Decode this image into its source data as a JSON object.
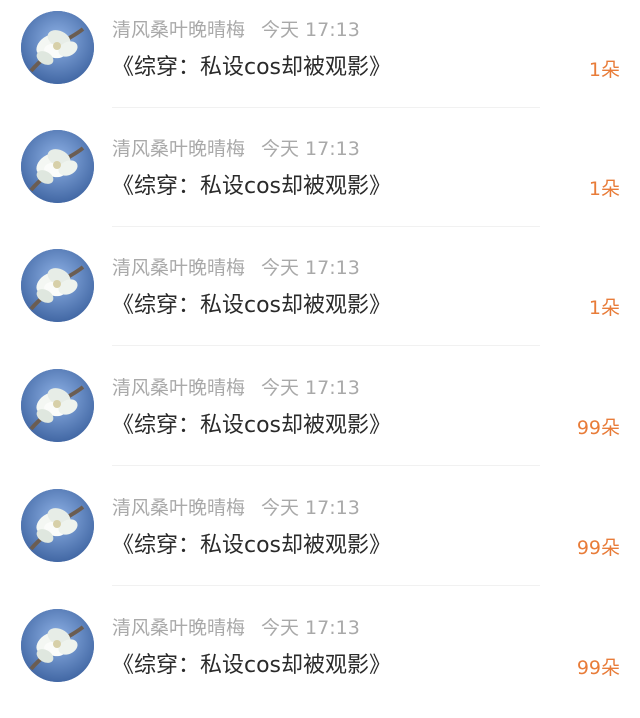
{
  "rows": [
    {
      "name": "清风桑叶晚晴梅",
      "time": "今天 17:13",
      "title": "《综穿：私设cos却被观影》",
      "amount": "1朵"
    },
    {
      "name": "清风桑叶晚晴梅",
      "time": "今天 17:13",
      "title": "《综穿：私设cos却被观影》",
      "amount": "1朵"
    },
    {
      "name": "清风桑叶晚晴梅",
      "time": "今天 17:13",
      "title": "《综穿：私设cos却被观影》",
      "amount": "1朵"
    },
    {
      "name": "清风桑叶晚晴梅",
      "time": "今天 17:13",
      "title": "《综穿：私设cos却被观影》",
      "amount": "99朵"
    },
    {
      "name": "清风桑叶晚晴梅",
      "time": "今天 17:13",
      "title": "《综穿：私设cos却被观影》",
      "amount": "99朵"
    },
    {
      "name": "清风桑叶晚晴梅",
      "time": "今天 17:13",
      "title": "《综穿：私设cos却被观影》",
      "amount": "99朵"
    }
  ]
}
